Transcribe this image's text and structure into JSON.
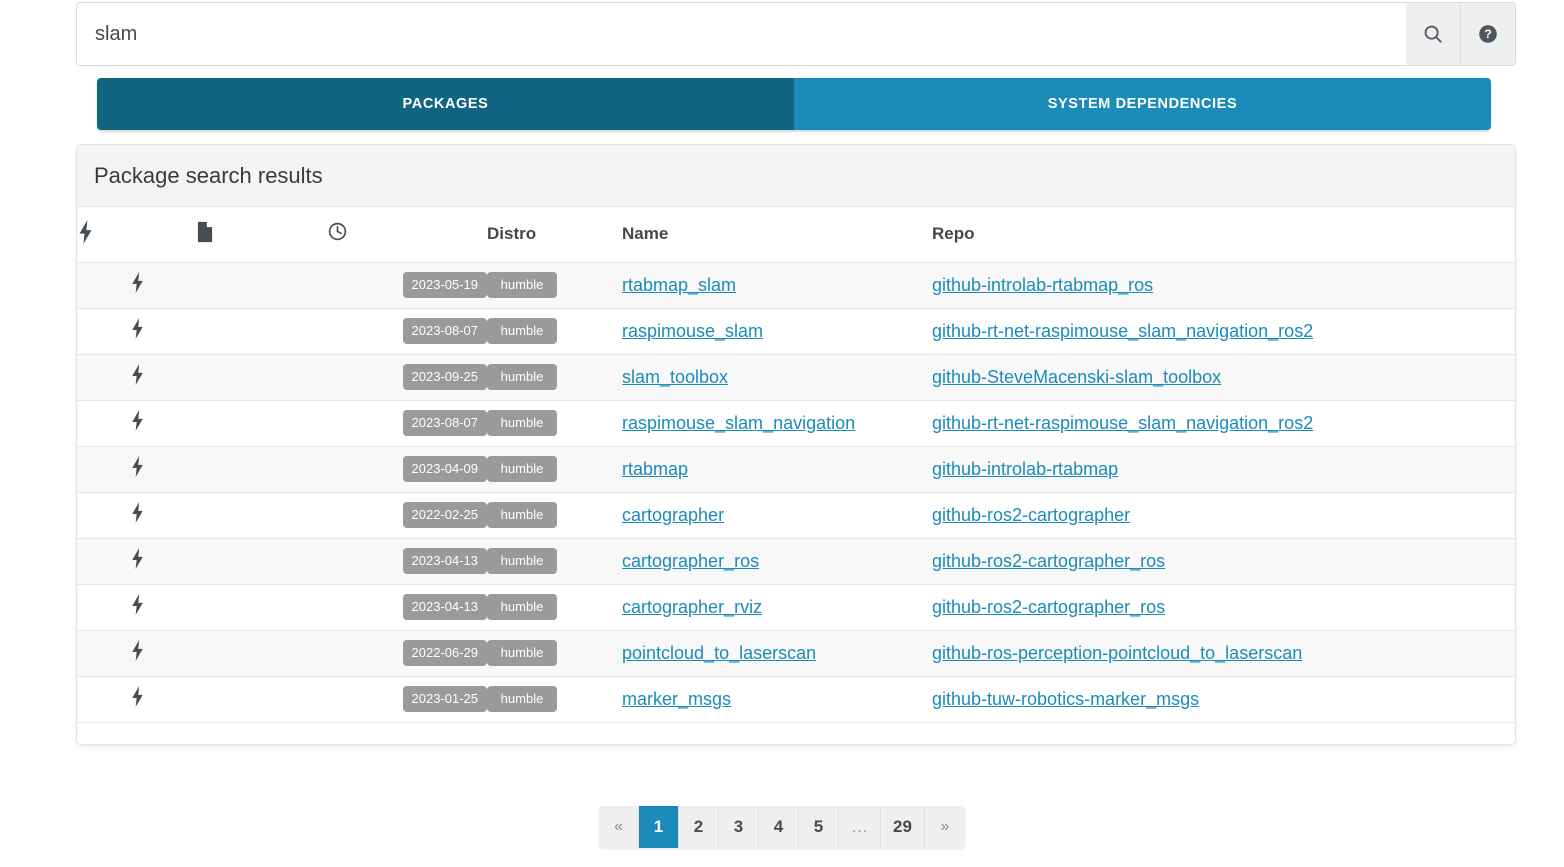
{
  "search": {
    "value": "slam",
    "placeholder": "Search",
    "search_icon": "search-icon",
    "help_icon": "help-circle-icon"
  },
  "tabs": [
    {
      "label": "Packages",
      "active": true
    },
    {
      "label": "System Dependencies",
      "active": false
    }
  ],
  "panel": {
    "title": "Package search results"
  },
  "table": {
    "headers": {
      "bolt_icon": "lightning-bolt-icon",
      "doc_icon": "document-icon",
      "clock_icon": "clock-icon",
      "distro": "Distro",
      "name": "Name",
      "repo": "Repo"
    },
    "rows": [
      {
        "date": "2023-05-19",
        "distro": "humble",
        "name": "rtabmap_slam",
        "repo": "github-introlab-rtabmap_ros"
      },
      {
        "date": "2023-08-07",
        "distro": "humble",
        "name": "raspimouse_slam",
        "repo": "github-rt-net-raspimouse_slam_navigation_ros2"
      },
      {
        "date": "2023-09-25",
        "distro": "humble",
        "name": "slam_toolbox",
        "repo": "github-SteveMacenski-slam_toolbox"
      },
      {
        "date": "2023-08-07",
        "distro": "humble",
        "name": "raspimouse_slam_navigation",
        "repo": "github-rt-net-raspimouse_slam_navigation_ros2"
      },
      {
        "date": "2023-04-09",
        "distro": "humble",
        "name": "rtabmap",
        "repo": "github-introlab-rtabmap"
      },
      {
        "date": "2022-02-25",
        "distro": "humble",
        "name": "cartographer",
        "repo": "github-ros2-cartographer"
      },
      {
        "date": "2023-04-13",
        "distro": "humble",
        "name": "cartographer_ros",
        "repo": "github-ros2-cartographer_ros"
      },
      {
        "date": "2023-04-13",
        "distro": "humble",
        "name": "cartographer_rviz",
        "repo": "github-ros2-cartographer_ros"
      },
      {
        "date": "2022-06-29",
        "distro": "humble",
        "name": "pointcloud_to_laserscan",
        "repo": "github-ros-perception-pointcloud_to_laserscan"
      },
      {
        "date": "2023-01-25",
        "distro": "humble",
        "name": "marker_msgs",
        "repo": "github-tuw-robotics-marker_msgs"
      }
    ]
  },
  "pagination": {
    "items": [
      {
        "label": "«",
        "type": "arrow",
        "active": false
      },
      {
        "label": "1",
        "type": "page",
        "active": true
      },
      {
        "label": "2",
        "type": "page",
        "active": false
      },
      {
        "label": "3",
        "type": "page",
        "active": false
      },
      {
        "label": "4",
        "type": "page",
        "active": false
      },
      {
        "label": "5",
        "type": "page",
        "active": false
      },
      {
        "label": "…",
        "type": "dots",
        "active": false
      },
      {
        "label": "29",
        "type": "page",
        "active": false
      },
      {
        "label": "»",
        "type": "arrow",
        "active": false
      }
    ]
  },
  "colors": {
    "tab_active": "#126580",
    "tab_inactive": "#1b8cba",
    "link": "#1b8cba",
    "badge": "#9a9a9a",
    "pagination_active": "#1b8cba"
  }
}
